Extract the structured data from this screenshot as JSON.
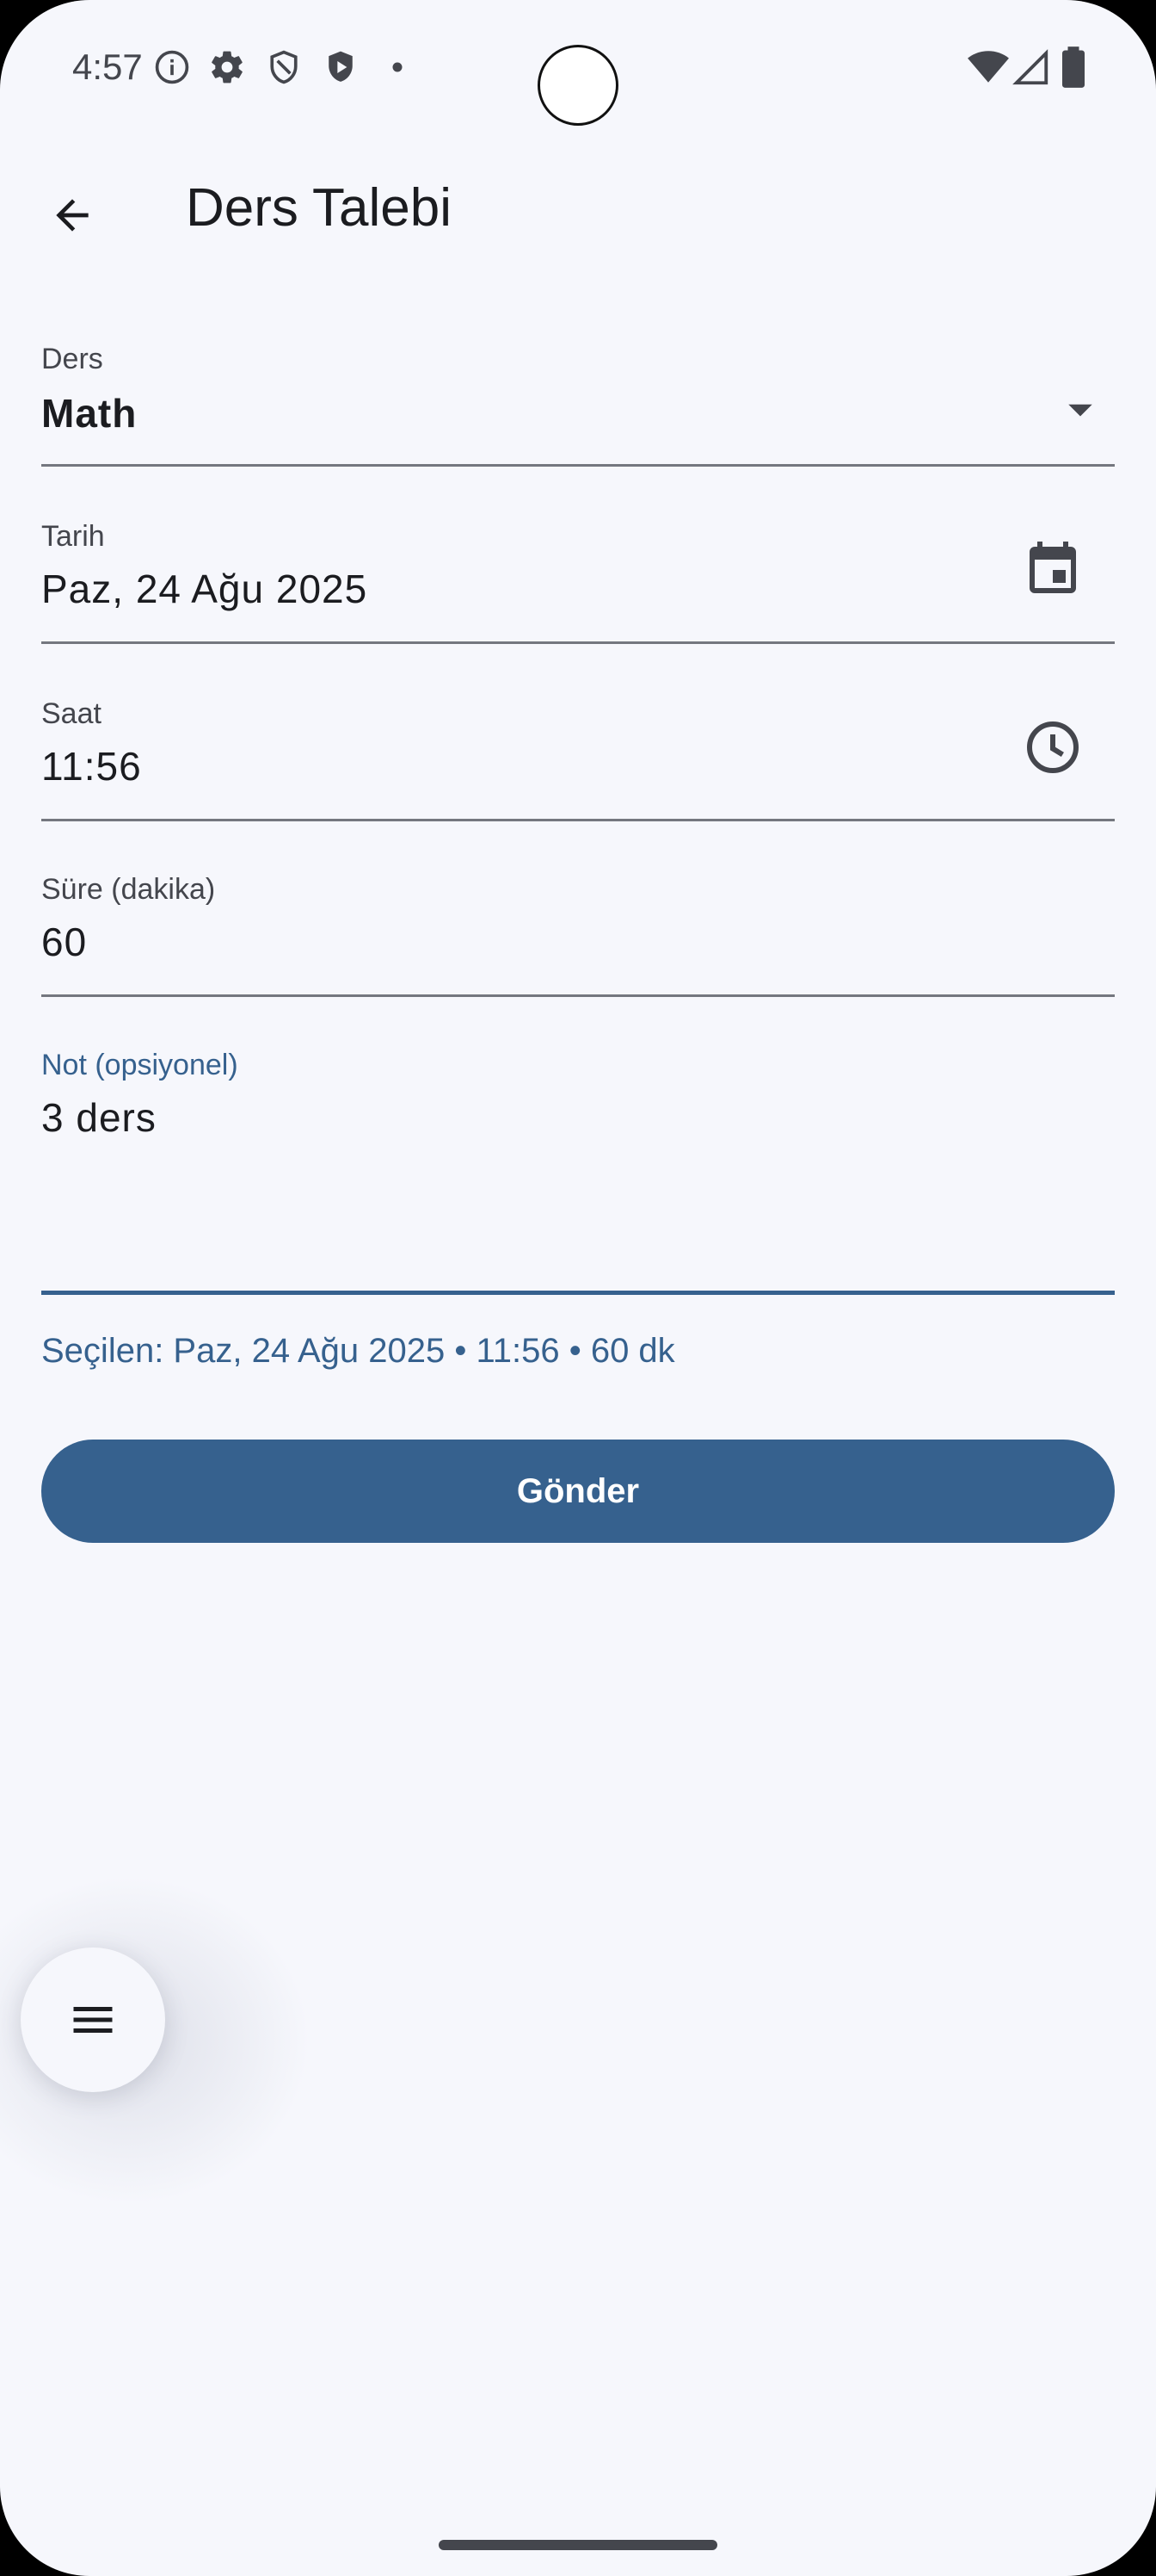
{
  "status_bar": {
    "time": "4:57",
    "left_icons": [
      "info-icon",
      "settings-icon",
      "shield-icon",
      "play-shield-icon",
      "dot-icon"
    ],
    "right_icons": [
      "wifi-icon",
      "signal-icon",
      "battery-icon"
    ]
  },
  "app_bar": {
    "title": "Ders Talebi",
    "back_icon": "arrow-back-icon"
  },
  "form": {
    "course": {
      "label": "Ders",
      "value": "Math",
      "icon": "dropdown-arrow-icon"
    },
    "date": {
      "label": "Tarih",
      "value": "Paz, 24 Ağu 2025",
      "icon": "calendar-icon"
    },
    "time": {
      "label": "Saat",
      "value": "11:56",
      "icon": "clock-icon"
    },
    "duration": {
      "label": "Süre (dakika)",
      "value": "60"
    },
    "note": {
      "label": "Not (opsiyonel)",
      "value": "3 ders",
      "focused": true
    }
  },
  "summary": "Seçilen: Paz, 24 Ağu 2025 • 11:56 • 60 dk",
  "submit_label": "Gönder",
  "fab_icon": "menu-icon",
  "colors": {
    "primary": "#36618e",
    "background": "#f6f7fc",
    "on_surface": "#1b1c20",
    "on_surface_variant": "#44464d",
    "outline": "#74777f"
  }
}
